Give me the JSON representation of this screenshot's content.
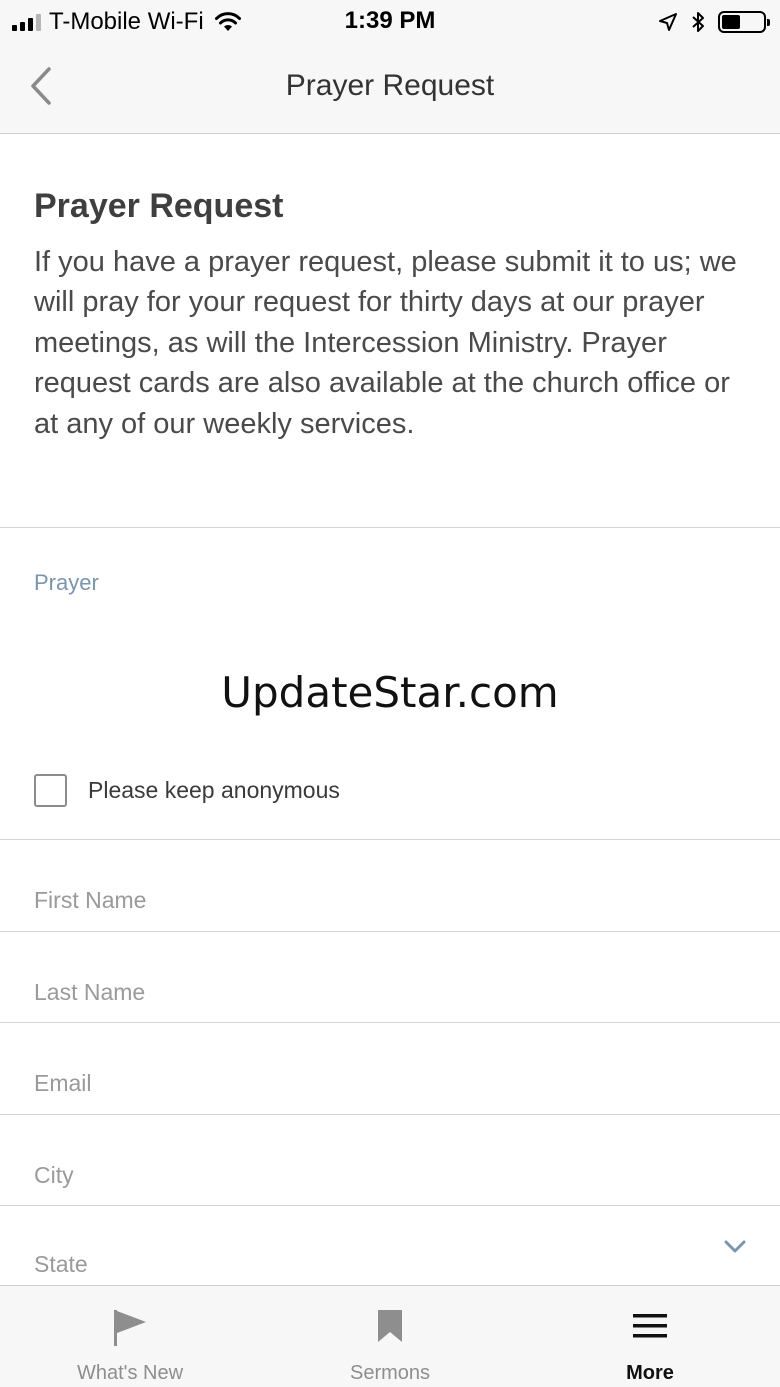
{
  "status_bar": {
    "carrier": "T-Mobile Wi-Fi",
    "time": "1:39 PM",
    "battery_level": 0.45,
    "icons": [
      "signal-icon",
      "wifi-icon",
      "location-icon",
      "bluetooth-icon",
      "battery-icon"
    ]
  },
  "nav": {
    "title": "Prayer Request",
    "back_icon": "chevron-left-icon"
  },
  "intro": {
    "heading": "Prayer Request",
    "body": "If you have a prayer request, please submit it to us; we will pray for your request for thirty days at our prayer meetings, as will the Intercession Ministry. Prayer request cards are also available at the church office or at any of our weekly services."
  },
  "form": {
    "prayer_label": "Prayer",
    "watermark": "UpdateStar.com",
    "anonymous_label": "Please keep anonymous",
    "first_name_placeholder": "First Name",
    "last_name_placeholder": "Last Name",
    "email_placeholder": "Email",
    "city_placeholder": "City",
    "state_label": "State"
  },
  "tabs": [
    {
      "label": "What's New",
      "icon": "flag-icon",
      "active": false
    },
    {
      "label": "Sermons",
      "icon": "bookmark-icon",
      "active": false
    },
    {
      "label": "More",
      "icon": "menu-icon",
      "active": true
    }
  ],
  "colors": {
    "accent": "#7a95ad",
    "text": "#4a4a4a",
    "placeholder": "#9a9a9a",
    "bar_background": "#f7f7f7"
  }
}
